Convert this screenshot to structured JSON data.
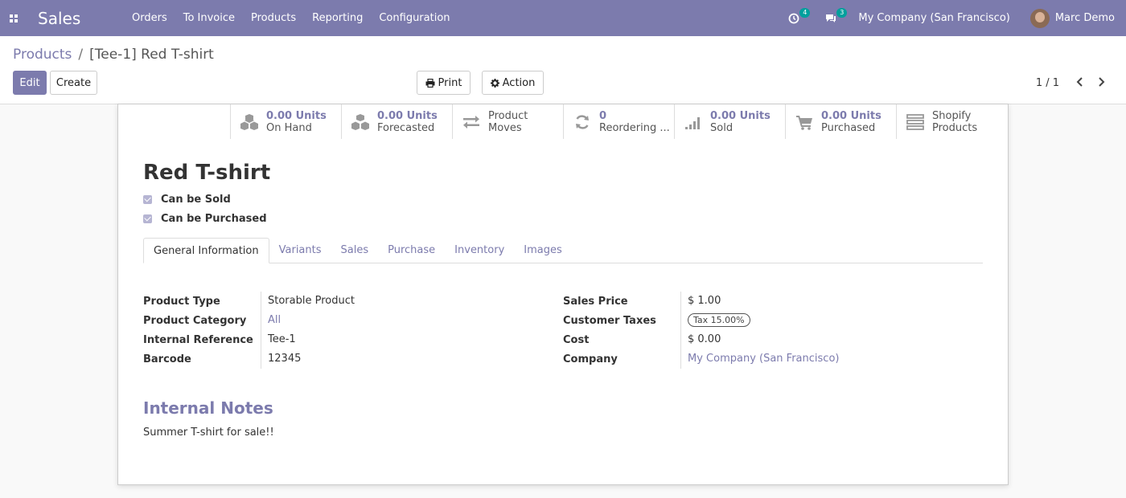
{
  "navbar": {
    "app_title": "Sales",
    "menu": [
      "Orders",
      "To Invoice",
      "Products",
      "Reporting",
      "Configuration"
    ],
    "activity_count": "4",
    "message_count": "3",
    "company": "My Company (San Francisco)",
    "user": "Marc Demo",
    "bg_color": "#7c7bad"
  },
  "breadcrumb": {
    "parent": "Products",
    "separator": "/",
    "current": "[Tee-1] Red T-shirt"
  },
  "buttons": {
    "edit": "Edit",
    "create": "Create",
    "print": "Print",
    "action": "Action"
  },
  "pager": {
    "text": "1 / 1"
  },
  "smart_buttons": [
    {
      "icon": "cubes-icon",
      "value": "0.00 Units",
      "label": "On Hand"
    },
    {
      "icon": "cubes-icon",
      "value": "0.00 Units",
      "label": "Forecasted"
    },
    {
      "icon": "exchange-icon",
      "value": "Product",
      "label": "Moves"
    },
    {
      "icon": "refresh-icon",
      "value": "0",
      "label": "Reordering ..."
    },
    {
      "icon": "signal-icon",
      "value": "0.00 Units",
      "label": "Sold"
    },
    {
      "icon": "cart-icon",
      "value": "0.00 Units",
      "label": "Purchased"
    },
    {
      "icon": "list-icon",
      "value": "Shopify",
      "label": "Products"
    }
  ],
  "product": {
    "name": "Red T-shirt",
    "can_be_sold": "Can be Sold",
    "can_be_purchased": "Can be Purchased"
  },
  "tabs": [
    "General Information",
    "Variants",
    "Sales",
    "Purchase",
    "Inventory",
    "Images"
  ],
  "left_fields": [
    {
      "label": "Product Type",
      "value": "Storable Product"
    },
    {
      "label": "Product Category",
      "value": "All"
    },
    {
      "label": "Internal Reference",
      "value": "Tee-1"
    },
    {
      "label": "Barcode",
      "value": "12345"
    }
  ],
  "right_fields": [
    {
      "label": "Sales Price",
      "value": "$ 1.00"
    },
    {
      "label": "Customer Taxes",
      "value": "Tax 15.00%"
    },
    {
      "label": "Cost",
      "value": "$ 0.00"
    },
    {
      "label": "Company",
      "value": "My Company (San Francisco)"
    }
  ],
  "notes": {
    "title": "Internal Notes",
    "text": "Summer T-shirt for sale!!"
  }
}
